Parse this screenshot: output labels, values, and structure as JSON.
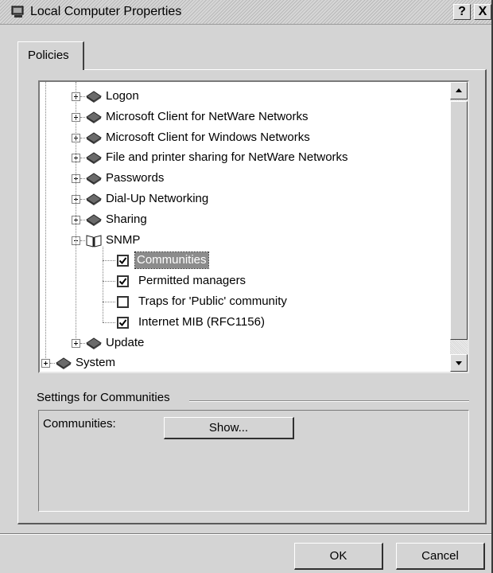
{
  "window": {
    "title": "Local Computer Properties",
    "help_label": "?",
    "close_label": "X"
  },
  "tabs": [
    {
      "label": "Policies",
      "selected": true
    }
  ],
  "tree": {
    "items": [
      {
        "label": "Logon",
        "type": "folder",
        "expander": "plus"
      },
      {
        "label": "Microsoft Client for NetWare Networks",
        "type": "folder",
        "expander": "plus"
      },
      {
        "label": "Microsoft Client for Windows Networks",
        "type": "folder",
        "expander": "plus"
      },
      {
        "label": "File and printer sharing for NetWare Networks",
        "type": "folder",
        "expander": "plus"
      },
      {
        "label": "Passwords",
        "type": "folder",
        "expander": "plus"
      },
      {
        "label": "Dial-Up Networking",
        "type": "folder",
        "expander": "plus"
      },
      {
        "label": "Sharing",
        "type": "folder",
        "expander": "plus"
      },
      {
        "label": "SNMP",
        "type": "folder-open",
        "expander": "minus"
      },
      {
        "label": "Communities",
        "type": "checkbox",
        "checked": true,
        "selected": true
      },
      {
        "label": "Permitted managers",
        "type": "checkbox",
        "checked": true
      },
      {
        "label": "Traps for 'Public' community",
        "type": "checkbox",
        "checked": false
      },
      {
        "label": "Internet MIB (RFC1156)",
        "type": "checkbox",
        "checked": true
      },
      {
        "label": "Update",
        "type": "folder",
        "expander": "plus"
      },
      {
        "label": "System",
        "type": "folder",
        "expander": "plus"
      }
    ]
  },
  "settings": {
    "label": "Settings for Communities",
    "field_label": "Communities:",
    "show_button": "Show..."
  },
  "buttons": {
    "ok": "OK",
    "cancel": "Cancel"
  }
}
